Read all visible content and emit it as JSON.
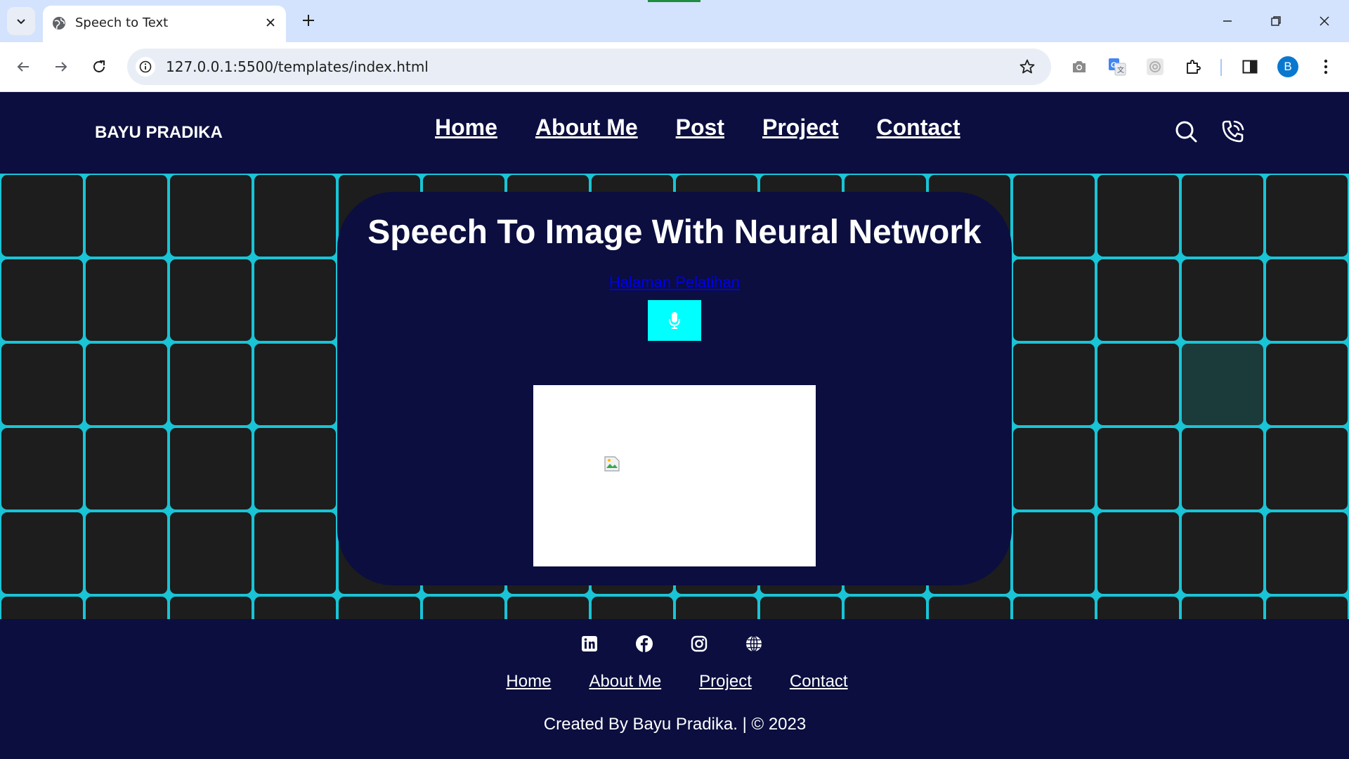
{
  "browser": {
    "tab_title": "Speech to Text",
    "url": "127.0.0.1:5500/templates/index.html",
    "profile_initial": "B"
  },
  "site": {
    "brand": "BAYU PRADIKA",
    "nav": [
      "Home",
      "About Me",
      "Post",
      "Project",
      "Contact"
    ]
  },
  "hero": {
    "title": "Speech To Image With Neural Network",
    "link_text": "Halaman Pelatihan"
  },
  "footer": {
    "social_icons": [
      "linkedin-icon",
      "facebook-icon",
      "instagram-icon",
      "globe-icon"
    ],
    "links": [
      "Home",
      "About Me",
      "Project",
      "Contact"
    ],
    "copyright": "Created By Bayu Pradika. | © 2023"
  },
  "colors": {
    "page_bg": "#0b0e3f",
    "grid_line": "#19c4d6",
    "cell": "#1d1d1d",
    "mic_button": "#00ffff",
    "link": "#0000ee"
  }
}
